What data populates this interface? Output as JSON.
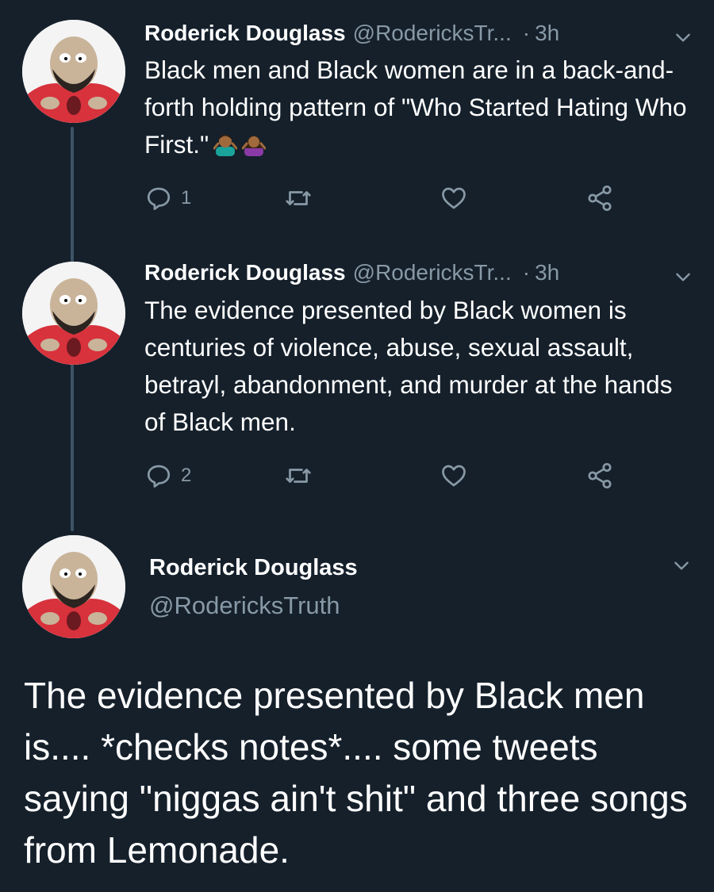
{
  "tweets": [
    {
      "author": "Roderick Douglass",
      "handle": "@RodericksTr...",
      "separator": "·",
      "time": "3h",
      "text": "Black men and Black women are in a back-and-forth holding pattern of \"Who Started Hating Who First.\"",
      "emojis": [
        "man-shrugging-emoji",
        "woman-shrugging-emoji"
      ],
      "reply_count": "1"
    },
    {
      "author": "Roderick Douglass",
      "handle": "@RodericksTr...",
      "separator": "·",
      "time": "3h",
      "text": "The evidence presented by Black women is centuries of violence, abuse, sexual assault, betrayl, abandonment, and murder at the hands of Black men.",
      "reply_count": "2"
    }
  ],
  "main_tweet": {
    "author": "Roderick Douglass",
    "handle": "@RodericksTruth",
    "text": "The evidence presented by Black men is.... *checks notes*.... some tweets saying \"niggas ain't shit\" and three songs from Lemonade."
  },
  "colors": {
    "background": "#15202b",
    "secondary_text": "#8899a6",
    "thread_line": "#3d5466"
  },
  "icons": [
    "reply-icon",
    "retweet-icon",
    "like-icon",
    "share-icon",
    "chevron-down-icon"
  ]
}
